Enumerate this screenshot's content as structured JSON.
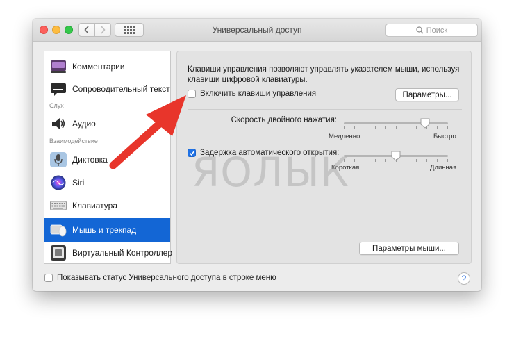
{
  "window": {
    "title": "Универсальный доступ",
    "search_placeholder": "Поиск"
  },
  "sidebar": {
    "items": [
      {
        "label": "Комментарии",
        "icon": "comments-icon"
      },
      {
        "label": "Сопроводительный текст",
        "icon": "captions-icon"
      },
      {
        "label": "Аудио",
        "icon": "speaker-icon"
      },
      {
        "label": "Диктовка",
        "icon": "microphone-icon"
      },
      {
        "label": "Siri",
        "icon": "siri-icon"
      },
      {
        "label": "Клавиатура",
        "icon": "keyboard-icon"
      },
      {
        "label": "Мышь и трекпад",
        "icon": "mouse-trackpad-icon",
        "selected": true
      },
      {
        "label": "Виртуальный Контроллер",
        "icon": "switch-control-icon"
      }
    ],
    "sections": {
      "hearing": "Слух",
      "interaction": "Взаимодействие"
    }
  },
  "panel": {
    "description": "Клавиши управления позволяют управлять указателем мыши, используя клавиши цифровой клавиатуры.",
    "enable_mouse_keys": {
      "label": "Включить клавиши управления",
      "checked": false
    },
    "options_button": "Параметры...",
    "double_click_speed": {
      "label": "Скорость двойного нажатия:",
      "min_label": "Медленно",
      "max_label": "Быстро",
      "value": 0.78
    },
    "spring_loading": {
      "label": "Задержка автоматического открытия:",
      "checked": true,
      "min_label": "Короткая",
      "max_label": "Длинная",
      "value": 0.5
    },
    "mouse_options_button": "Параметры мыши..."
  },
  "footer": {
    "show_status_label": "Показывать статус Универсального доступа в строке меню",
    "show_status_checked": false,
    "help_label": "?"
  },
  "watermark": "ЯОЛЫК",
  "colors": {
    "selection": "#1366d5",
    "checkbox_checked": "#1f72e6",
    "arrow": "#e8352b"
  }
}
